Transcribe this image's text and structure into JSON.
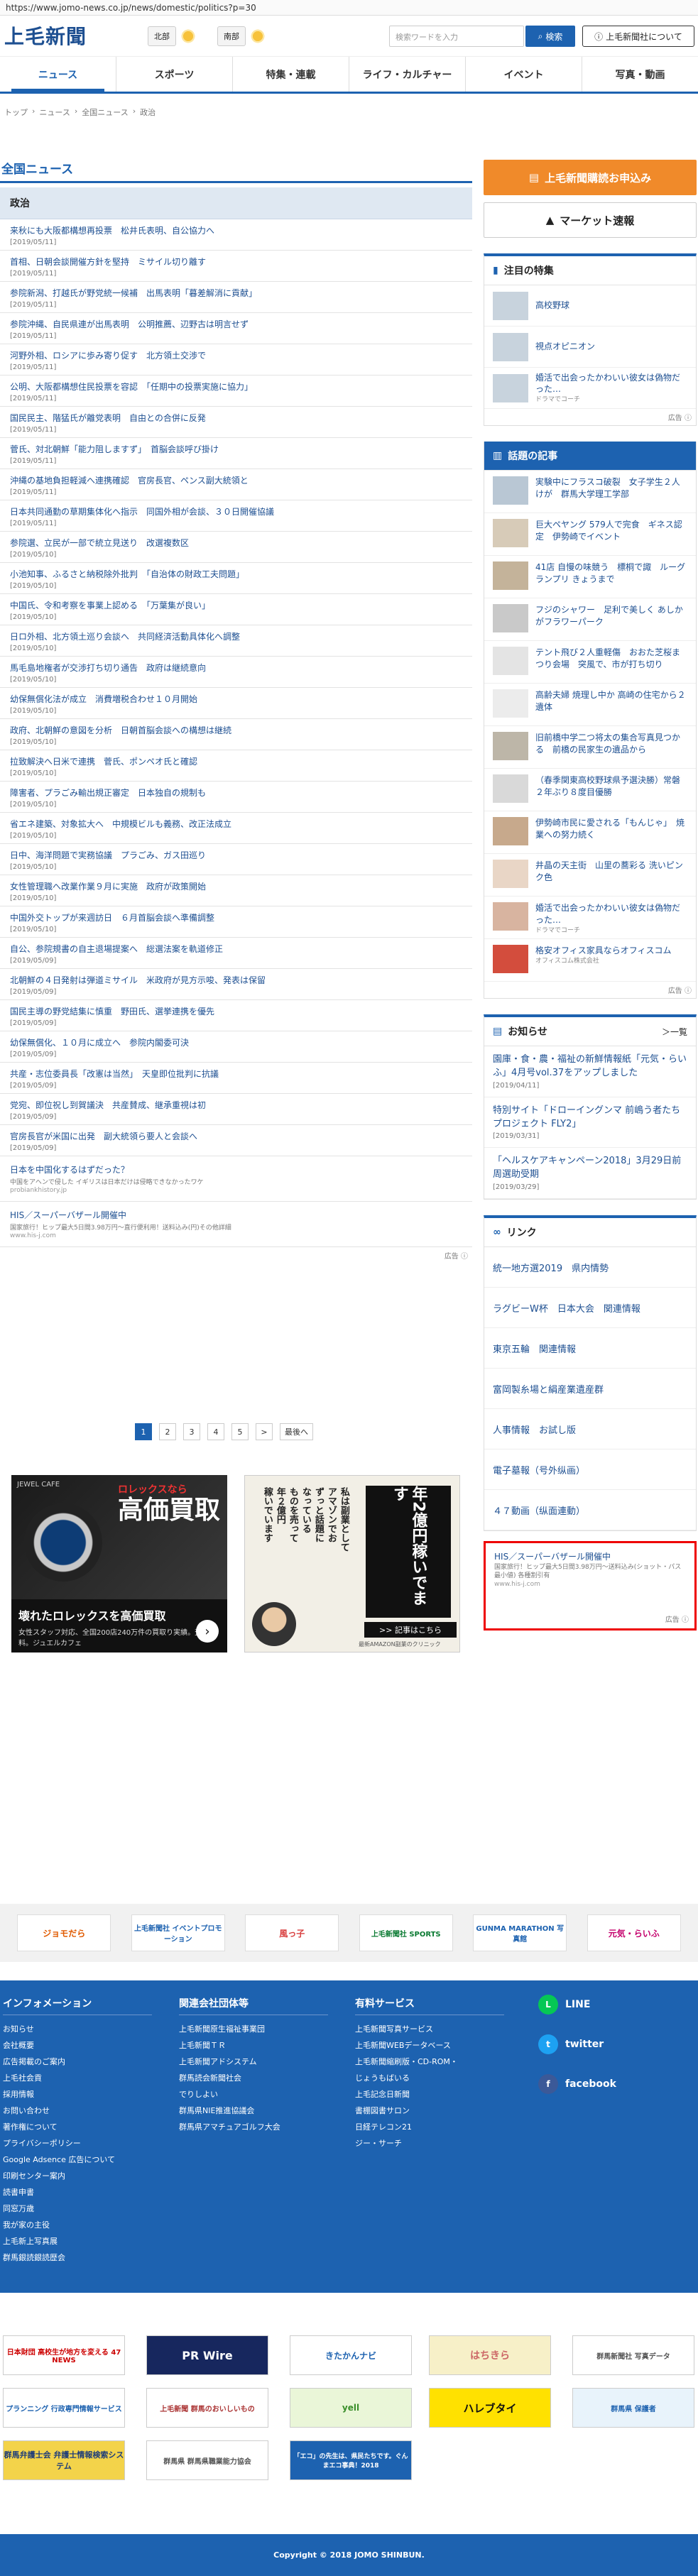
{
  "browser": {
    "url": "https://www.jomo-news.co.jp/news/domestic/politics?p=30"
  },
  "header": {
    "logo": "上毛新聞",
    "weather_north": "北部",
    "weather_south": "南部",
    "search_placeholder": "検索ワードを入力",
    "search_button": "検索",
    "about_button": "上毛新聞社について"
  },
  "nav": {
    "tabs": [
      "ニュース",
      "スポーツ",
      "特集・連載",
      "ライフ・カルチャー",
      "イベント",
      "写真・動画"
    ]
  },
  "breadcrumb": [
    "トップ",
    "›",
    "ニュース",
    "›",
    "全国ニュース",
    "›",
    "政治"
  ],
  "main": {
    "section_title": "全国ニュース",
    "category": "政治",
    "articles": [
      {
        "title": "来秋にも大阪都構想再投票　松井氏表明、自公協力へ",
        "date": "[2019/05/11]"
      },
      {
        "title": "首相、日朝会談開催方針を堅持　ミサイル切り離す",
        "date": "[2019/05/11]"
      },
      {
        "title": "参院新潟、打越氏が野党統一候補　出馬表明「暮差解消に貢献」",
        "date": "[2019/05/11]"
      },
      {
        "title": "参院沖縄、自民県連が出馬表明　公明推薦、辺野古は明言せず",
        "date": "[2019/05/11]"
      },
      {
        "title": "河野外相、ロシアに歩み寄り促す　北方領土交渉で",
        "date": "[2019/05/11]"
      },
      {
        "title": "公明、大阪都構想住民投票を容認　「任期中の投票実施に協力」",
        "date": "[2019/05/11]"
      },
      {
        "title": "国民民主、階猛氏が離党表明　自由との合併に反発",
        "date": "[2019/05/11]"
      },
      {
        "title": "菅氏、対北朝鮮「能力阻しますず」　首脳会談呼び掛け",
        "date": "[2019/05/11]"
      },
      {
        "title": "沖縄の基地負担軽減へ連携確認　官房長官、ペンス副大統領と",
        "date": "[2019/05/11]"
      },
      {
        "title": "日本共同通勤の草期集体化へ指示　同国外相が会談、３０日開催協議",
        "date": "[2019/05/11]"
      },
      {
        "title": "参院選、立民が一部で統立見送り　改選複数区",
        "date": "[2019/05/10]"
      },
      {
        "title": "小池知事、ふるさと納税除外批判　「自治体の財政工夫問題」",
        "date": "[2019/05/10]"
      },
      {
        "title": "中国氏、令和考察を事業上認める　「万葉集が良い」",
        "date": "[2019/05/10]"
      },
      {
        "title": "日ロ外相、北方領土巡り会談へ　共同経済活動具体化へ調整",
        "date": "[2019/05/10]"
      },
      {
        "title": "馬毛島地権者が交渉打ち切り通告　政府は継続意向",
        "date": "[2019/05/10]"
      },
      {
        "title": "幼保無償化法が成立　消費増税合わせ１０月開始",
        "date": "[2019/05/10]"
      },
      {
        "title": "政府、北朝鮮の意図を分析　日朝首脳会談への構想は継続",
        "date": "[2019/05/10]"
      },
      {
        "title": "拉致解決へ日米で連携　菅氏、ポンペオ氏と確認",
        "date": "[2019/05/10]"
      },
      {
        "title": "障害者、プラごみ輸出規正審定　日本独自の規制も",
        "date": "[2019/05/10]"
      },
      {
        "title": "省エネ建築、対象拡大へ　中規模ビルも義務、改正法成立",
        "date": "[2019/05/10]"
      },
      {
        "title": "日中、海洋問題で実務協議　プラごみ、ガス田巡り",
        "date": "[2019/05/10]"
      },
      {
        "title": "女性管理職へ改業作業９月に実施　政府が政策開始",
        "date": "[2019/05/10]"
      },
      {
        "title": "中国外交トップが来週訪日　６月首脳会談へ準備調整",
        "date": "[2019/05/10]"
      },
      {
        "title": "自公、参院規書の自主退場提案へ　総選法案を軌道修正",
        "date": "[2019/05/09]"
      },
      {
        "title": "北朝鮮の４日発射は弾道ミサイル　米政府が見方示唆、発表は保留",
        "date": "[2019/05/09]"
      },
      {
        "title": "国民主導の野党結集に慎重　野田氏、選挙連携を優先",
        "date": "[2019/05/09]"
      },
      {
        "title": "幼保無償化、１０月に成立へ　参院内閣委可決",
        "date": "[2019/05/09]"
      },
      {
        "title": "共産・志位委員長「改憲は当然」　天皇即位批判に抗議",
        "date": "[2019/05/09]"
      },
      {
        "title": "党宛、即位祝し到賀議決　共産賛成、継承重視は初",
        "date": "[2019/05/09]"
      },
      {
        "title": "官房長官が米国に出発　副大統領ら要人と会談へ",
        "date": "[2019/05/09]"
      }
    ],
    "text_ads": [
      {
        "title": "日本を中国化するはずだった？",
        "sub": "中国をアヘンで侵した イギリスは日本だけは侵略できなかったワケ",
        "url": "probiankhistory.jp"
      },
      {
        "title": "HIS／スーパーバザール開催中",
        "sub": "国家旅行！ヒップ最大5日間3.98万円～直行便利用！送料込み(円)その他詳細",
        "url": "www.his-j.com"
      }
    ],
    "ad_label": "広告 ⓘ"
  },
  "pager": [
    "1",
    "2",
    "3",
    "4",
    "5",
    ">",
    "最後へ"
  ],
  "banners": {
    "rolex": {
      "brand": "JEWEL CAFE",
      "red": "ロレックスなら",
      "big": "高価買取",
      "headline": "壊れたロレックスを高価買取",
      "sub": "女性スタッフ対応、全国200店240万件の買取り実績。査定無料。ジュエルカフェ"
    },
    "amazon": {
      "lines": [
        "私は副業として",
        "アマゾンでお",
        "ずっと話題に",
        "なっている",
        "ものを売って",
        "年２億円",
        "稼いでいます"
      ],
      "yen": "年2億円稼いでます",
      "cta": ">> 記事はこちら",
      "foot": "最新AMAZON副業のクリニック"
    }
  },
  "sidebar": {
    "subscribe": "上毛新聞購読お申込み",
    "market": "マーケット速報",
    "featured_title": "注目の特集",
    "featured": [
      {
        "title": "高校野球",
        "sub": ""
      },
      {
        "title": "視点オピニオン",
        "sub": ""
      },
      {
        "title": "婚活で出会ったかわいい彼女は偽物だった…",
        "sub": "ドラマでコーチ"
      }
    ],
    "popular_title": "話題の記事",
    "popular": [
      {
        "title": "実験中にフラスコ破裂　女子学生２人けが　群馬大学理工学部",
        "sub": ""
      },
      {
        "title": "巨大ペヤング 579人で完食　ギネス認定　伊勢崎でイベント",
        "sub": ""
      },
      {
        "title": "41店 自慢の味競う　標桐で諏　ルーグランプリ きょうまで",
        "sub": ""
      },
      {
        "title": "フジのシャワー　足利で美しく あしかがフラワーパーク",
        "sub": ""
      },
      {
        "title": "テント飛び２人重軽傷　おおた芝桜まつり会場　突風で、市が打ち切り",
        "sub": ""
      },
      {
        "title": "高齢夫婦 焼理し中か 高崎の住宅から２遺体",
        "sub": ""
      },
      {
        "title": "旧前橋中学二つ将太の集合写真見つかる　前橋の民家生の遺品から",
        "sub": ""
      },
      {
        "title": "（春季関東高校野球県予選決勝）常磐 ２年ぶり８度目優勝",
        "sub": ""
      },
      {
        "title": "伊勢崎市民に愛される「もんじゃ」　焼業への努力続く",
        "sub": ""
      },
      {
        "title": "井晶の天主街　山里の蕎彩る 洗いピンク色",
        "sub": ""
      },
      {
        "title": "婚活で出会ったかわいい彼女は偽物だった…",
        "sub": "ドラマでコーチ"
      },
      {
        "title": "格安オフィス家具ならオフィスコム",
        "sub": "オフィスコム株式会社"
      }
    ],
    "news_title": "お知らせ",
    "news_more": "＞一覧",
    "notices": [
      {
        "title": "園庫・食・農・福祉の新鮮情報紙「元気・らいふ」4月号vol.37をアップしました",
        "date": "[2019/04/11]"
      },
      {
        "title": "特別サイト「ドローイングンマ 前嶋う者たちプロジェクト FLY2」",
        "date": "[2019/03/31]"
      },
      {
        "title": "「ヘルスケアキャンペーン2018」3月29日前周選助受期",
        "date": "[2019/03/29]"
      }
    ],
    "links_title": "リンク",
    "links": [
      "統一地方選2019　県内情勢",
      "ラグビーW杯　日本大会　関連情報",
      "東京五輪　関連情報",
      "富岡製糸場と絹産業遺産群",
      "人事情報　お試し版",
      "電子墓報（号外纵画）",
      "４７動画（纵面連動）"
    ],
    "side_ad": {
      "title": "HIS／スーパーバザール開催中",
      "sub": "国家旅行！ヒップ最大5日間3.98万円～送料込み(ショット・パス最小値) 各種割引有",
      "url": "www.his-j.com"
    }
  },
  "partners": [
    "ジョモだら",
    "上毛新聞社 イベントプロモーション",
    "風っ子",
    "上毛新聞社 SPORTS",
    "GUNMA MARATHON 写真館",
    "元気・らいふ"
  ],
  "footer": {
    "col1_title": "インフォメーション",
    "col1": [
      "お知らせ",
      "会社概要",
      "広告掲載のご案内",
      "上毛社会貢",
      "採用情報",
      "お問い合わせ",
      "著作権について",
      "プライバシーポリシー",
      "Google Adsence 広告について",
      "印刷センター案内",
      "読書申書",
      "同窓万歳",
      "我が家の主役",
      "上毛新上写真展",
      "群馬銀読銀読歴会"
    ],
    "col2_title": "関連会社団体等",
    "col2": [
      "上毛新聞原生福祉事業団",
      "上毛新聞ＴＲ",
      "上毛新聞アドシステム",
      "群馬読会新聞社会",
      "でりしよい",
      "群馬県NIE推進協議会",
      "群馬県アマチュアゴルフ大会"
    ],
    "col3_title": "有料サービス",
    "col3": [
      "上毛新聞写真サービス",
      "上毛新聞WEBデータベース",
      "上毛新聞縮刷版・CD-ROM・",
      "じょうもばいる",
      "上毛記念日新聞",
      "書棚図書サロン",
      "日経テレコン21",
      "ジー・サーチ"
    ],
    "social": [
      "LINE",
      "twitter",
      "facebook"
    ]
  },
  "footer_banners": [
    "日本財団 高校生が地方を変える 47 NEWS",
    "PR Wire",
    "きたかんナビ",
    "はちきら",
    "群馬新聞社 写真データ",
    "プランニング 行政専門情報サービス",
    "上毛新聞 群馬のおいしいもの",
    "yell",
    "ハレブタイ",
    "群馬県 保護者",
    "群馬弁護士会 弁護士情報検索システム",
    "群馬県 群馬県職業能力協会",
    "「エコ」の先生は、県民たちです。ぐんまエコ事典！2018"
  ],
  "copyright": "Copyright © 2018 JOMO SHINBUN."
}
